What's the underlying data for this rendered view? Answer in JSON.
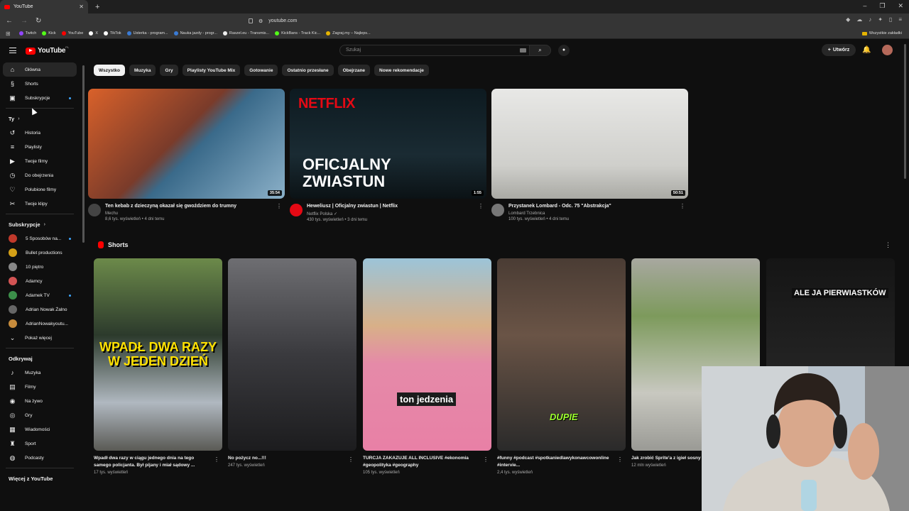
{
  "browser": {
    "tab_title": "YouTube",
    "new_tab": "+",
    "url": "youtube.com",
    "bookmarks": [
      {
        "label": "Twitch",
        "color": "#9146ff"
      },
      {
        "label": "Kick",
        "color": "#53fc18"
      },
      {
        "label": "YouTube",
        "color": "#ff0000"
      },
      {
        "label": "X",
        "color": "#ffffff"
      },
      {
        "label": "TikTok",
        "color": "#ffffff"
      },
      {
        "label": "Usterka - program...",
        "color": "#3a7bd5"
      },
      {
        "label": "Nauka jazdy - progr...",
        "color": "#3a7bd5"
      },
      {
        "label": "Raszel.eu - Transmis...",
        "color": "#eeeeee"
      },
      {
        "label": "KickBans - Track Kic...",
        "color": "#53fc18"
      },
      {
        "label": "Zagraj.my – Najleps...",
        "color": "#e6b400"
      }
    ],
    "all_bookmarks": "Wszystkie zakładki"
  },
  "header": {
    "logo": "YouTube",
    "country": "PL",
    "search_placeholder": "Szukaj",
    "create_label": "Utwórz"
  },
  "sidebar": {
    "main": [
      {
        "label": "Główna",
        "icon": "home-icon",
        "glyph": "⌂"
      },
      {
        "label": "Shorts",
        "icon": "shorts-icon",
        "glyph": "§"
      },
      {
        "label": "Subskrypcje",
        "icon": "subscriptions-icon",
        "glyph": "▣"
      }
    ],
    "you_header": "Ty",
    "you": [
      {
        "label": "Historia",
        "icon": "history-icon",
        "glyph": "↺"
      },
      {
        "label": "Playlisty",
        "icon": "playlists-icon",
        "glyph": "≡"
      },
      {
        "label": "Twoje filmy",
        "icon": "your-videos-icon",
        "glyph": "▶"
      },
      {
        "label": "Do obejrzenia",
        "icon": "watch-later-icon",
        "glyph": "◷"
      },
      {
        "label": "Polubione filmy",
        "icon": "liked-icon",
        "glyph": "♡"
      },
      {
        "label": "Twoje klipy",
        "icon": "clips-icon",
        "glyph": "✂"
      }
    ],
    "subs_header": "Subskrypcje",
    "subs": [
      {
        "label": "5 Sposobów na...",
        "color": "#c0392b"
      },
      {
        "label": "Bullet productions",
        "color": "#d4a017"
      },
      {
        "label": "10 piętro",
        "color": "#888888"
      },
      {
        "label": "Adamcy",
        "color": "#d35454"
      },
      {
        "label": "Adamek TV",
        "color": "#3c8f4a"
      },
      {
        "label": "Adrian Nowak Żalno",
        "color": "#666666"
      },
      {
        "label": "AdrianNowakyoutu...",
        "color": "#c78c3c"
      }
    ],
    "show_more": "Pokaż więcej",
    "explore_header": "Odkrywaj",
    "explore": [
      {
        "label": "Muzyka",
        "icon": "music-icon",
        "glyph": "♪"
      },
      {
        "label": "Filmy",
        "icon": "movies-icon",
        "glyph": "▤"
      },
      {
        "label": "Na żywo",
        "icon": "live-icon",
        "glyph": "◉"
      },
      {
        "label": "Gry",
        "icon": "gaming-icon",
        "glyph": "◎"
      },
      {
        "label": "Wiadomości",
        "icon": "news-icon",
        "glyph": "▦"
      },
      {
        "label": "Sport",
        "icon": "sport-icon",
        "glyph": "♜"
      },
      {
        "label": "Podcasty",
        "icon": "podcasts-icon",
        "glyph": "◍"
      }
    ],
    "more_header": "Więcej z YouTube"
  },
  "chips": [
    "Wszystko",
    "Muzyka",
    "Gry",
    "Playlisty YouTube Mix",
    "Gotowanie",
    "Ostatnio przesłane",
    "Obejrzane",
    "Nowe rekomendacje"
  ],
  "videos": [
    {
      "title": "Ten kebab z dzieczyną okazał się gwoździem do trumny",
      "channel": "Mechu",
      "stats": "8,6 tys. wyświetleń • 4 dni temu",
      "duration": "35:54",
      "bg": "linear-gradient(135deg,#d9612a 0%,#7a3b2a 45%,#3a6a8a 55%,#8bb0c8 100%)",
      "avatar": "#444444"
    },
    {
      "title": "Heweliusz | Oficjalny zwiastun | Netflix",
      "channel": "Netflix Polska ✓",
      "stats": "430 tys. wyświetleń • 3 dni temu",
      "duration": "1:55",
      "bg": "linear-gradient(180deg,#0d1a20 0%,#1a2b33 60%,#0b1215 100%)",
      "avatar": "#e50914",
      "overlay_brand": "NETFLIX",
      "overlay_line1": "OFICJALNY",
      "overlay_line2": "ZWIASTUN"
    },
    {
      "title": "Przystanek Lombard - Odc. 75 \"Abstrakcja\"",
      "channel": "Lombard Trzebnica",
      "stats": "100 tys. wyświetleń • 4 dni temu",
      "duration": "50:51",
      "bg": "linear-gradient(180deg,#e8e8e6 0%,#cfcfcb 70%,#a9a9a4 100%)",
      "avatar": "#777777"
    }
  ],
  "shorts_header": "Shorts",
  "shorts": [
    {
      "title": "Wpadł dwa razy w ciągu jednego dnia na tego samego policjanta. Był pijany i miał sądowy ...",
      "views": "17 tys. wyświetleń",
      "bg": "linear-gradient(180deg,#6c8a4a 0%,#2c3a2c 40%,#b0b8c0 75%,#5a5a55 100%)",
      "overlay": "WPADŁ DWA RAZY W JEDEN DZIEŃ"
    },
    {
      "title": "No pożycz no...!!!",
      "views": "247 tys. wyświetleń",
      "bg": "linear-gradient(180deg,#6e6e72 0%,#3a3a3e 50%,#1c1c1e 100%)"
    },
    {
      "title": "TURCJA ZAKAZUJE ALL INCLUSIVE #ekonomia #geopolityka #geography",
      "views": "105 tys. wyświetleń",
      "bg": "linear-gradient(180deg,#9cc4d8 0%,#d8b088 35%,#e58aa8 55%,#e880a6 100%)",
      "overlay": "ton jedzenia"
    },
    {
      "title": "#funny #podcast #spotkaniedlawykonawcowonline #intervie...",
      "views": "2,4 tys. wyświetleń",
      "bg": "linear-gradient(180deg,#4a3c34 0%,#6a5446 40%,#2a2a2a 100%)",
      "overlay": "DUPIE"
    },
    {
      "title": "Jak zrobić Sprite'a z igieł sosny",
      "views": "12 mln wyświetleń",
      "bg": "linear-gradient(180deg,#a8a8a0 0%,#7d9a5c 30%,#c8c8c0 70%,#9a9a95 100%)"
    },
    {
      "title": "",
      "views": "",
      "bg": "linear-gradient(180deg,#151515 0%,#242424 60%,#3a3a3a 100%)",
      "overlay": "ALE JA PIERWIASTKÓW"
    }
  ]
}
